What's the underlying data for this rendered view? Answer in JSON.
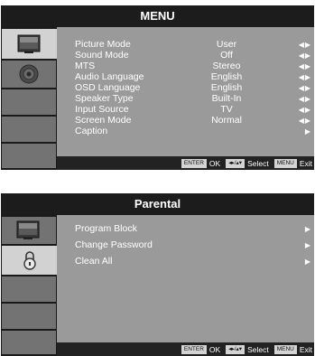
{
  "menu": {
    "title": "MENU",
    "rows": [
      {
        "label": "Picture Mode",
        "value": "User",
        "arrows": "◀▶"
      },
      {
        "label": "Sound Mode",
        "value": "Off",
        "arrows": "◀▶"
      },
      {
        "label": "MTS",
        "value": "Stereo",
        "arrows": "◀▶"
      },
      {
        "label": "Audio Language",
        "value": "English",
        "arrows": "◀▶"
      },
      {
        "label": "OSD Language",
        "value": "English",
        "arrows": "◀▶"
      },
      {
        "label": "Speaker Type",
        "value": "Built-In",
        "arrows": "◀▶"
      },
      {
        "label": "Input Source",
        "value": "TV",
        "arrows": "◀▶"
      },
      {
        "label": "Screen Mode",
        "value": "Normal",
        "arrows": "◀▶"
      },
      {
        "label": "Caption",
        "value": "",
        "arrows": "▶"
      }
    ],
    "footer": {
      "enter": "ENTER",
      "ok": "OK",
      "nav": "◂▸/▴▾",
      "select": "Select",
      "menu": "MENU",
      "exit": "Exit"
    },
    "tabs": [
      {
        "icon": "tv-picture-icon",
        "selected": true
      },
      {
        "icon": "speaker-icon",
        "selected": false
      },
      {
        "icon": "",
        "selected": false
      },
      {
        "icon": "",
        "selected": false
      },
      {
        "icon": "",
        "selected": false
      }
    ]
  },
  "parental": {
    "title": "Parental",
    "rows": [
      {
        "label": "Program Block",
        "arrows": "▶"
      },
      {
        "label": "Change Password",
        "arrows": "▶"
      },
      {
        "label": "Clean All",
        "arrows": "▶"
      }
    ],
    "footer": {
      "enter": "ENTER",
      "ok": "OK",
      "nav": "◂▸/▴▾",
      "select": "Select",
      "menu": "MENU",
      "exit": "Exit"
    },
    "tabs": [
      {
        "icon": "tv-picture-icon",
        "selected": false
      },
      {
        "icon": "lock-icon",
        "selected": true
      },
      {
        "icon": "",
        "selected": false
      },
      {
        "icon": "",
        "selected": false
      },
      {
        "icon": "",
        "selected": false
      }
    ]
  },
  "colors": {
    "title_bg": "#1c1c1c",
    "content_bg": "#9a9a9a",
    "tab_bg": "#737373",
    "tab_selected": "#d2d2d2",
    "text": "#ffffff"
  }
}
